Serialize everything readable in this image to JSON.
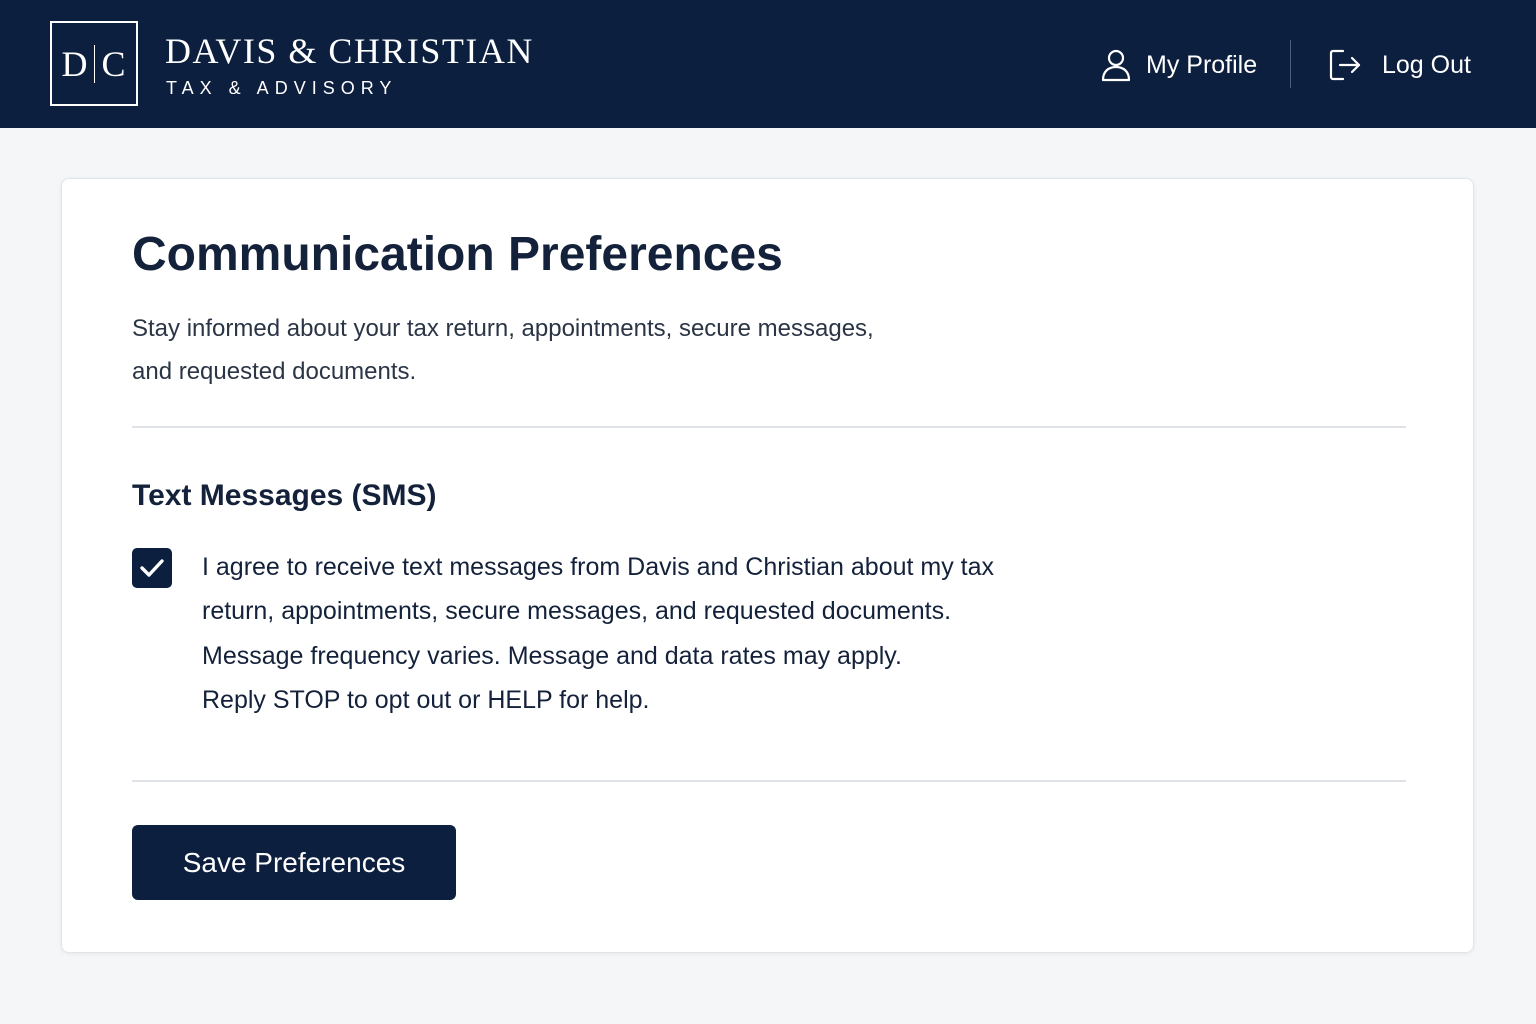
{
  "header": {
    "logo_left": "D",
    "logo_right": "C",
    "brand_name": "DAVIS & CHRISTIAN",
    "brand_subtitle": "TAX & ADVISORY",
    "nav": {
      "profile_label": "My Profile",
      "profile_icon": "user-icon",
      "logout_label": "Log Out",
      "logout_icon": "logout-icon"
    },
    "background_color": "#0c1f3f"
  },
  "main": {
    "title": "Communication Preferences",
    "intro_lines": [
      "Stay informed about your tax return, appointments, secure messages,",
      "and requested documents."
    ],
    "sms": {
      "title": "Text Messages (SMS)",
      "checked": true,
      "consent_lines": [
        "I agree to receive text messages from Davis and Christian about my tax",
        "return, appointments, secure messages, and requested documents.",
        "Message frequency varies. Message and data rates may apply.",
        "Reply STOP to opt out or HELP for help."
      ]
    },
    "save_label": "Save Preferences"
  },
  "colors": {
    "brand_navy": "#0c1f3f",
    "page_background": "#f4f6f8",
    "card_background": "#ffffff"
  }
}
